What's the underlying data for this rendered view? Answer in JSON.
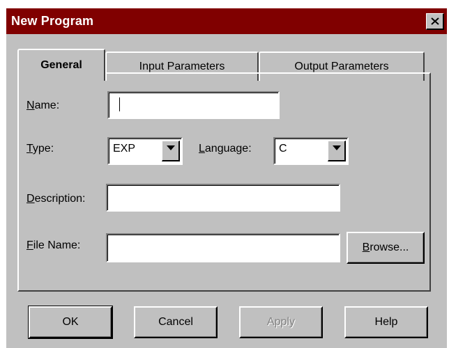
{
  "window": {
    "title": "New Program",
    "close_icon": "close-icon"
  },
  "tabs": [
    {
      "label": "General",
      "active": true
    },
    {
      "label": "Input Parameters",
      "active": false
    },
    {
      "label": "Output Parameters",
      "active": false
    }
  ],
  "form": {
    "name": {
      "label_mnemonic": "N",
      "label_rest": "ame:",
      "value": ""
    },
    "type": {
      "label_mnemonic": "T",
      "label_rest": "ype:",
      "value": "EXP"
    },
    "language": {
      "label_mnemonic": "L",
      "label_rest": "anguage:",
      "value": "C"
    },
    "description": {
      "label_mnemonic": "D",
      "label_rest": "escription:",
      "value": ""
    },
    "file_name": {
      "label_mnemonic": "F",
      "label_rest": "ile Name:",
      "value": ""
    },
    "browse": {
      "label_mnemonic": "B",
      "label_rest": "rowse..."
    }
  },
  "buttons": {
    "ok": "OK",
    "cancel": "Cancel",
    "apply": "Apply",
    "help": "Help"
  },
  "colors": {
    "titlebar": "#800000",
    "face": "#c0c0c0",
    "disabled_text": "#808080"
  }
}
